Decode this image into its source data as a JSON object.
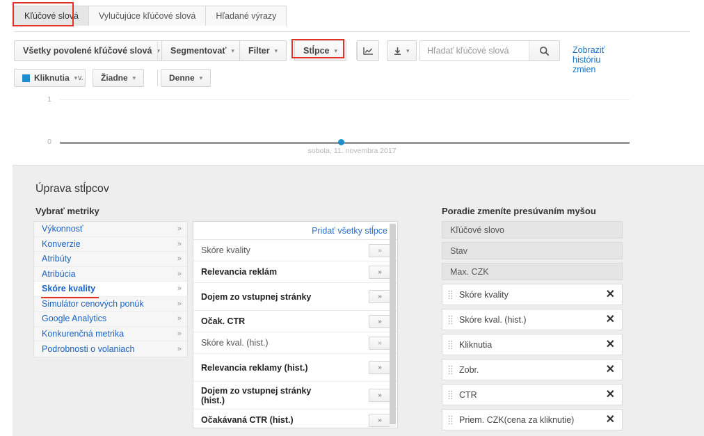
{
  "tabs": [
    {
      "label": "Kľúčové slová",
      "active": true
    },
    {
      "label": "Vylučujúce kľúčové slová",
      "active": false
    },
    {
      "label": "Hľadané výrazy",
      "active": false
    }
  ],
  "toolbar": {
    "filter_all": "Všetky povolené kľúčové slová",
    "segment": "Segmentovať",
    "filter": "Filter",
    "columns": "Stĺpce",
    "chart_icon": "chart-icon",
    "download_icon": "download-icon",
    "search_placeholder": "Hľadať kľúčové slová",
    "search_value": "",
    "search_icon": "search-icon",
    "history_link": "Zobraziť históriu zmien",
    "metric": "Kliknutia",
    "metric_color": "#1d8ecb",
    "vs": "v.",
    "compare": "Žiadne",
    "granularity": "Denne",
    "caret": "▾"
  },
  "chart_data": {
    "type": "line",
    "title": "",
    "xlabel": "",
    "ylabel": "",
    "yticks": [
      "1",
      "0"
    ],
    "ylim": [
      0,
      1
    ],
    "grid": true,
    "legend": "Kliknutia",
    "series": [
      {
        "name": "Kliknutia",
        "color": "#1d8ecb",
        "x": [
          "sobota, 11. novembra 2017"
        ],
        "values": [
          0
        ]
      }
    ],
    "x_axis_label": "sobota, 11. novembra 2017",
    "point_count": 1
  },
  "panel": {
    "title": "Úprava stĺpcov",
    "metrics_heading": "Vybrať metriky",
    "order_heading": "Poradie zmeníte presúvaním myšou",
    "add_all": "Pridať všetky stĺpce",
    "chevron": "»",
    "remove_icon": "✕",
    "categories": [
      {
        "label": "Výkonnosť",
        "selected": false
      },
      {
        "label": "Konverzie",
        "selected": false
      },
      {
        "label": "Atribúty",
        "selected": false
      },
      {
        "label": "Atribúcia",
        "selected": false
      },
      {
        "label": "Skóre kvality",
        "selected": true
      },
      {
        "label": "Simulátor cenových ponúk",
        "selected": false
      },
      {
        "label": "Google Analytics",
        "selected": false
      },
      {
        "label": "Konkurenčná metrika",
        "selected": false
      },
      {
        "label": "Podrobnosti o volaniach",
        "selected": false
      }
    ],
    "metrics": [
      {
        "label": "Skóre kvality",
        "added": true
      },
      {
        "label": "Relevancia reklám",
        "added": false
      },
      {
        "label": "Dojem zo vstupnej stránky",
        "added": false
      },
      {
        "label": "Očak. CTR",
        "added": false
      },
      {
        "label": "Skóre kval. (hist.)",
        "added": true
      },
      {
        "label": "Relevancia reklamy (hist.)",
        "added": false
      },
      {
        "label": "Dojem zo vstupnej stránky (hist.)",
        "added": false
      },
      {
        "label": "Očakávaná CTR (hist.)",
        "added": false
      }
    ],
    "order": [
      {
        "label": "Kľúčové slovo",
        "fixed": true
      },
      {
        "label": "Stav",
        "fixed": true
      },
      {
        "label": "Max. CZK",
        "fixed": true
      },
      {
        "label": "Skóre kvality",
        "fixed": false
      },
      {
        "label": "Skóre kval. (hist.)",
        "fixed": false
      },
      {
        "label": "Kliknutia",
        "fixed": false
      },
      {
        "label": "Zobr.",
        "fixed": false
      },
      {
        "label": "CTR",
        "fixed": false
      },
      {
        "label": "Priem. CZK(cena za kliknutie)",
        "fixed": false
      }
    ]
  },
  "annotations": {
    "color": "#e33126"
  }
}
